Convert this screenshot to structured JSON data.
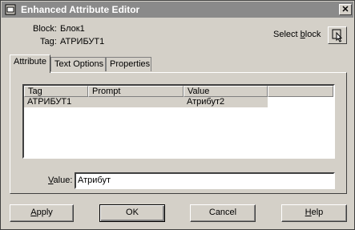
{
  "window": {
    "title": "Enhanced Attribute Editor",
    "close_glyph": "✕"
  },
  "info": {
    "block_label": "Block:",
    "block_value": "Блок1",
    "tag_label": "Tag:",
    "tag_value": "АТРИБУТ1"
  },
  "select_block": {
    "label_pre": "Select ",
    "label_hot": "b",
    "label_post": "lock",
    "icon": "pick-arrow-icon"
  },
  "tabs": [
    {
      "label": "Attribute",
      "active": true
    },
    {
      "label": "Text Options",
      "active": false
    },
    {
      "label": "Properties",
      "active": false
    }
  ],
  "table": {
    "columns": [
      "Tag",
      "Prompt",
      "Value"
    ],
    "rows": [
      {
        "tag": "АТРИБУТ1",
        "prompt": "",
        "value": "Атрибут2"
      }
    ]
  },
  "value_field": {
    "label_hot": "V",
    "label_post": "alue:",
    "value": "Атрибут"
  },
  "buttons": {
    "apply_hot": "A",
    "apply_post": "pply",
    "ok": "OK",
    "cancel": "Cancel",
    "help_hot": "H",
    "help_post": "elp"
  }
}
